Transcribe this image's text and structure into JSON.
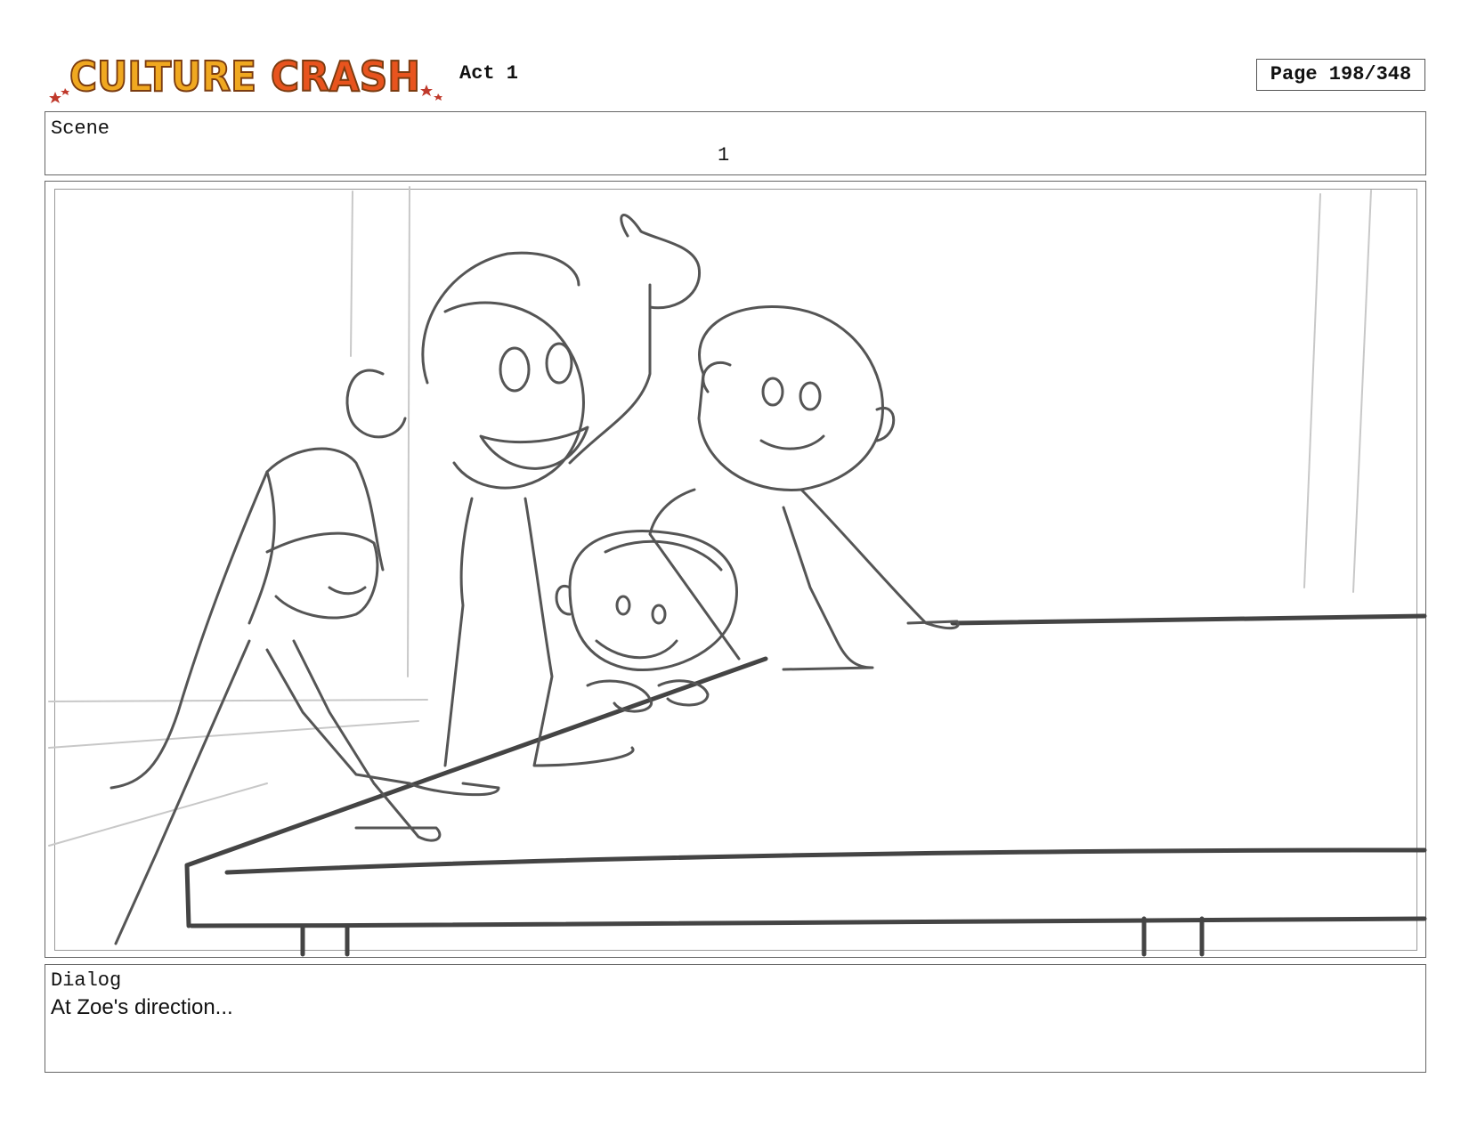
{
  "header": {
    "logo_text": "CULTURE CRASH",
    "act_label": "Act 1",
    "page_label": "Page 198/348"
  },
  "scene": {
    "label": "Scene",
    "number": "1"
  },
  "panel": {
    "art": "storyboard-sketch"
  },
  "dialog": {
    "label": "Dialog",
    "text": "At Zoe's direction..."
  },
  "colors": {
    "logo_yellow": "#f0a820",
    "logo_orange": "#e8541e",
    "logo_outline": "#7a3b10",
    "sketch": "#555555"
  }
}
